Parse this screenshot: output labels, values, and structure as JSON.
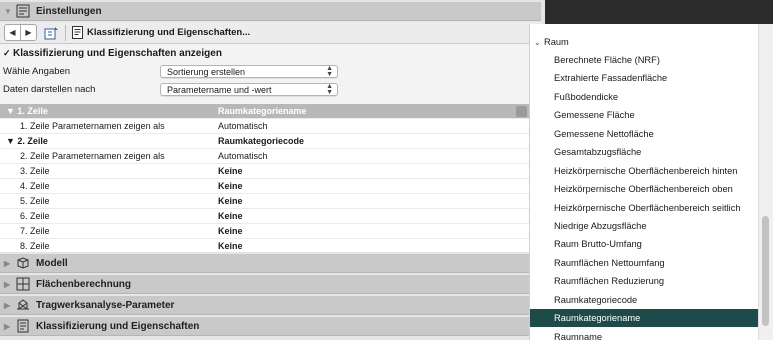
{
  "settings": {
    "header": "Einstellungen",
    "breadcrumb": "Klassifizierung und Eigenschaften...",
    "show_checkbox_label": "Klassifizierung und Eigenschaften anzeigen",
    "show_checked": true,
    "fields": [
      {
        "label": "Wähle Angaben",
        "value": "Sortierung erstellen"
      },
      {
        "label": "Daten darstellen nach",
        "value": "Parametername und -wert"
      }
    ]
  },
  "table": {
    "rows": [
      {
        "label": "1. Zeile",
        "value": "Raumkategoriename",
        "kind": "header"
      },
      {
        "label": "1. Zeile Parameternamen zeigen als",
        "value": "Automatisch",
        "kind": "sub"
      },
      {
        "label": "2. Zeile",
        "value": "Raumkategoriecode",
        "kind": "group"
      },
      {
        "label": "2. Zeile Parameternamen zeigen als",
        "value": "Automatisch",
        "kind": "sub"
      },
      {
        "label": "3. Zeile",
        "value": "Keine",
        "kind": "bold"
      },
      {
        "label": "4. Zeile",
        "value": "Keine",
        "kind": "bold"
      },
      {
        "label": "5. Zeile",
        "value": "Keine",
        "kind": "bold"
      },
      {
        "label": "6. Zeile",
        "value": "Keine",
        "kind": "bold"
      },
      {
        "label": "7. Zeile",
        "value": "Keine",
        "kind": "bold"
      },
      {
        "label": "8. Zeile",
        "value": "Keine",
        "kind": "bold"
      }
    ]
  },
  "sections": [
    {
      "title": "Modell",
      "icon": "model-icon"
    },
    {
      "title": "Flächenberechnung",
      "icon": "area-calc-icon"
    },
    {
      "title": "Tragwerksanalyse-Parameter",
      "icon": "structural-icon"
    },
    {
      "title": "Klassifizierung und Eigenschaften",
      "icon": "classification-icon"
    }
  ],
  "dropdown": {
    "group": "Raum",
    "items": [
      "Berechnete Fläche (NRF)",
      "Extrahierte Fassadenfläche",
      "Fußbodendicke",
      "Gemessene Fläche",
      "Gemessene Nettofläche",
      "Gesamtabzugsfläche",
      "Heizkörpernische Oberflächenbereich hinten",
      "Heizkörpernische Oberflächenbereich oben",
      "Heizkörpernische Oberflächenbereich seitlich",
      "Niedrige Abzugsfläche",
      "Raum Brutto-Umfang",
      "Raumflächen Nettoumfang",
      "Raumflächen Reduzierung",
      "Raumkategoriecode",
      "Raumkategoriename",
      "Raumname"
    ],
    "selected": "Raumkategoriename",
    "selected_color": "#1d4b4a"
  }
}
